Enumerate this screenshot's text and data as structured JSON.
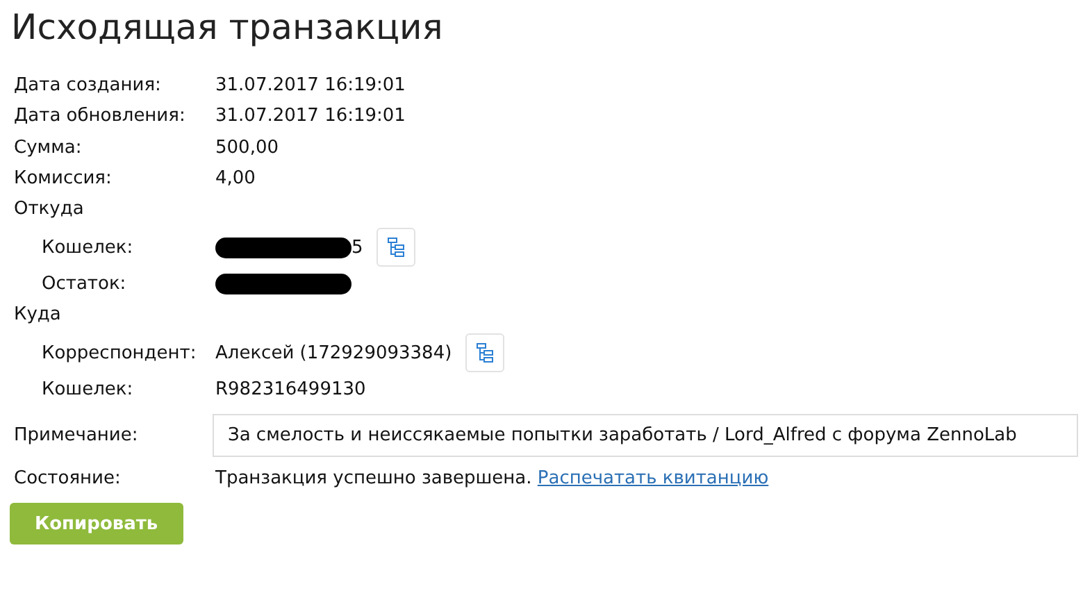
{
  "title": "Исходящая транзакция",
  "rows": [
    {
      "kind": "field",
      "label": "Дата создания:",
      "value": "31.07.2017 16:19:01"
    },
    {
      "kind": "field",
      "label": "Дата обновления:",
      "value": "31.07.2017 16:19:01"
    },
    {
      "kind": "field",
      "label": "Сумма:",
      "value": "500,00"
    },
    {
      "kind": "field",
      "label": "Комиссия:",
      "value": "4,00"
    },
    {
      "kind": "group",
      "label": "Откуда",
      "children": [
        {
          "kind": "field",
          "label": "Кошелек:",
          "value": "5",
          "redacted": true,
          "copy": true
        },
        {
          "kind": "field",
          "label": "Остаток:",
          "redacted": true
        }
      ]
    },
    {
      "kind": "group",
      "label": "Куда",
      "children": [
        {
          "kind": "field",
          "label": "Корреспондент:",
          "value": "Алексей (172929093384)",
          "copy": true
        },
        {
          "kind": "field",
          "label": "Кошелек:",
          "value": "R982316499130"
        }
      ]
    }
  ],
  "note": {
    "label": "Примечание:",
    "value": "За смелость и неиссякаемые попытки заработать / Lord_Alfred с форума ZennoLab"
  },
  "status": {
    "label": "Состояние:",
    "text": "Транзакция успешно завершена.",
    "link": "Распечатать квитанцию"
  },
  "button": "Копировать"
}
